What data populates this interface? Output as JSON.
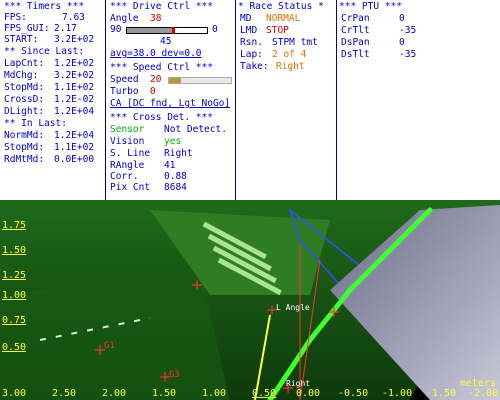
{
  "timers": {
    "header": "*** Timers ***",
    "fps_label": "FPS:",
    "fps": "7.63",
    "fpsgui_label": "FPS_GUI:",
    "fpsgui": "2.17",
    "start_label": "START:",
    "start": "3.2E+02",
    "since_header": "** Since Last:",
    "lapcnt_label": "LapCnt:",
    "lapcnt": "1.2E+02",
    "mdchg_label": "MdChg:",
    "mdchg": "3.2E+02",
    "stopmd_label": "StopMd:",
    "stopmd": "1.1E+02",
    "crossd_label": "CrossD:",
    "crossd": "1.2E-02",
    "dlight_label": "DLight:",
    "dlight": "1.2E+04",
    "inlast_header": "** In Last:",
    "normmd_label": "NormMd:",
    "normmd": "1.2E+04",
    "stopmd2_label": "StopMd:",
    "stopmd2": "1.1E+02",
    "rdmtmd_label": "RdMtMd:",
    "rdmtmd": "0.0E+00"
  },
  "drive": {
    "header": "*** Drive Ctrl ***",
    "angle_label": "Angle",
    "angle": "38",
    "slider_min": "90",
    "slider_max": "0",
    "slider_level": 0.58,
    "slider_mid": "45",
    "avg": "avg=38.0  dev=0.0"
  },
  "speed": {
    "header": "*** Speed Ctrl ***",
    "speed_label": "Speed",
    "speed": "20",
    "speed_level": 0.2,
    "turbo_label": "Turbo",
    "turbo": "0",
    "ca": "CA [DC fnd, Lgt NoGo]"
  },
  "cross": {
    "header": "*** Cross Det. ***",
    "sensor_label": "Sensor",
    "sensor": "Not Detect.",
    "vision_label": "Vision",
    "vision": "yes",
    "sline_label": "S. Line",
    "sline": "Right",
    "rangle_label": "RAngle",
    "rangle": "41",
    "corr_label": "Corr.",
    "corr": "0.88",
    "pix_label": "Pix Cnt",
    "pix": "8684"
  },
  "race": {
    "header": "* Race Status *",
    "md_label": "MD",
    "md": "NORMAL",
    "lmd_label": "LMD",
    "lmd": "STOP",
    "rsn_label": "Rsn.",
    "rsn": "STPM tmt",
    "lap_label": "Lap:",
    "lap": "2 of 4",
    "take_label": "Take:",
    "take": "Right"
  },
  "ptu": {
    "header": "*** PTU ***",
    "crpan_label": "CrPan",
    "crpan": "0",
    "crtlt_label": "CrTlt",
    "crtlt": "-35",
    "dspan_label": "DsPan",
    "dspan": "0",
    "dstlt_label": "DsTlt",
    "dstlt": "-35"
  },
  "view": {
    "y_ticks": [
      "1.75",
      "1.50",
      "1.25",
      "1.00",
      "0.75",
      "0.50"
    ],
    "x_ticks": [
      "3.00",
      "2.50",
      "2.00",
      "1.50",
      "1.00",
      "0.50",
      "0.00",
      "-0.50",
      "-1.00",
      "-1.50",
      "-2.00"
    ],
    "unit": "meters",
    "marker_g1": "G1",
    "marker_g3": "G3",
    "marker_langle": "L Angle",
    "marker_right": "Right"
  },
  "colors": {
    "label": "#0000cc",
    "value_red": "#cc0000",
    "value_orange": "#e07000",
    "value_green": "#00b000",
    "axis_text": "#ffff40",
    "marker": "#ff3030"
  }
}
